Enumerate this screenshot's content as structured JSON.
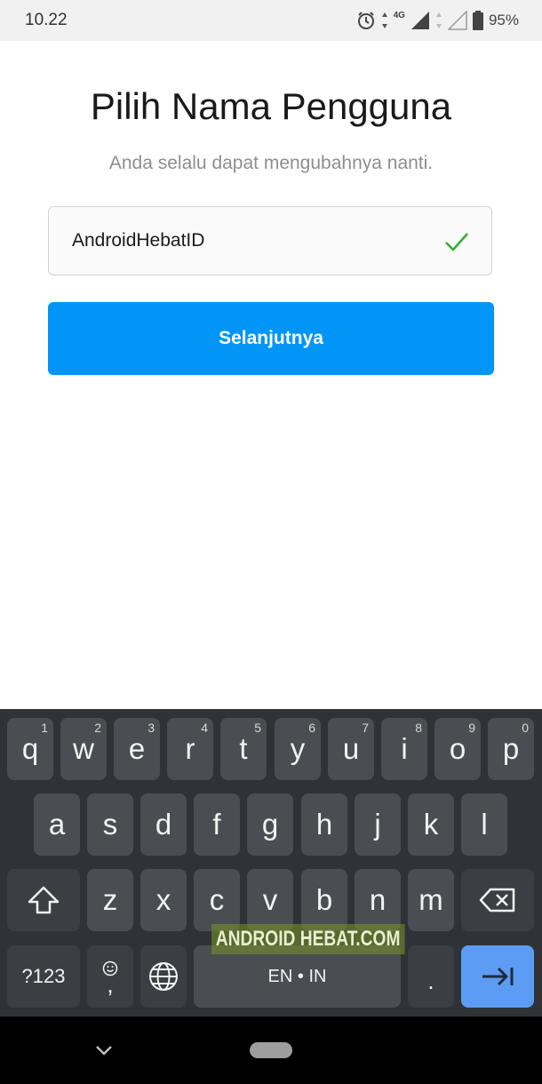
{
  "status_bar": {
    "time": "10.22",
    "network": "4G",
    "battery": "95%"
  },
  "screen": {
    "title": "Pilih Nama Pengguna",
    "subtitle": "Anda selalu dapat mengubahnya nanti.",
    "username_value": "AndroidHebatID",
    "next_label": "Selanjutnya"
  },
  "keyboard": {
    "row1": [
      {
        "key": "q",
        "num": "1"
      },
      {
        "key": "w",
        "num": "2"
      },
      {
        "key": "e",
        "num": "3"
      },
      {
        "key": "r",
        "num": "4"
      },
      {
        "key": "t",
        "num": "5"
      },
      {
        "key": "y",
        "num": "6"
      },
      {
        "key": "u",
        "num": "7"
      },
      {
        "key": "i",
        "num": "8"
      },
      {
        "key": "o",
        "num": "9"
      },
      {
        "key": "p",
        "num": "0"
      }
    ],
    "row2": [
      "a",
      "s",
      "d",
      "f",
      "g",
      "h",
      "j",
      "k",
      "l"
    ],
    "row3": [
      "z",
      "x",
      "c",
      "v",
      "b",
      "n",
      "m"
    ],
    "symbols_label": "?123",
    "emoji_comma": ",",
    "space_label": "EN • IN",
    "period": "."
  },
  "watermark": "ANDROID HEBAT.COM",
  "colors": {
    "accent": "#0095f6",
    "check": "#2cb12c",
    "keyboard_bg": "#2f3337",
    "key_bg": "#4a4e52",
    "enter_key": "#5d9cf5"
  },
  "icons": [
    "alarm-icon",
    "signal-icon",
    "battery-icon",
    "check-icon",
    "shift-icon",
    "backspace-icon",
    "emoji-icon",
    "globe-icon",
    "enter-icon",
    "nav-back-icon",
    "nav-home-icon"
  ]
}
